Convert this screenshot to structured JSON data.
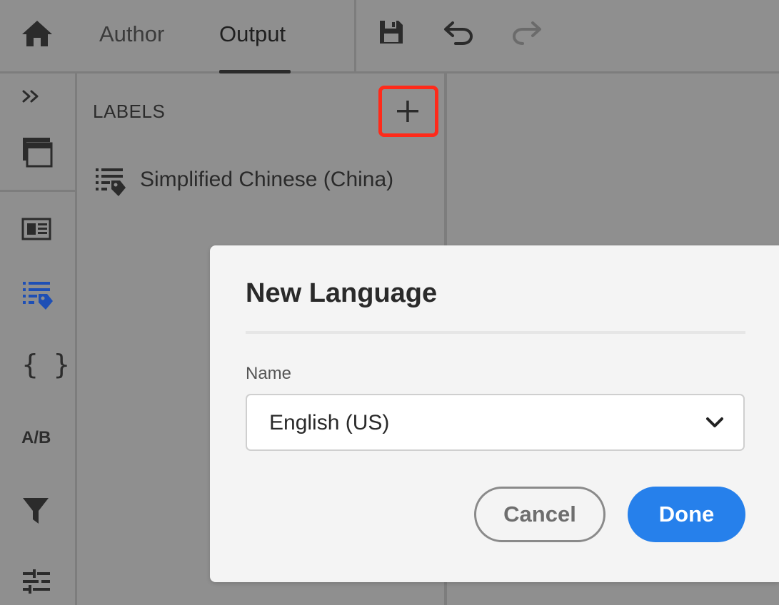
{
  "header": {
    "tabs": [
      {
        "label": "Author",
        "selected": false
      },
      {
        "label": "Output",
        "selected": true
      }
    ],
    "icons": [
      "home-icon",
      "save-icon",
      "undo-icon",
      "redo-icon"
    ]
  },
  "rail": {
    "icons": [
      "expand-icon",
      "panels-icon",
      "article-icon",
      "labels-icon",
      "braces-icon",
      "ab-test-icon",
      "filter-icon",
      "adjust-icon"
    ],
    "ab_label": "A/B",
    "braces_label": "{ }",
    "active_color": "#1e4fb5"
  },
  "labels_panel": {
    "title": "LABELS",
    "items": [
      {
        "label": "Simplified Chinese (China)",
        "icon": "label-list-icon"
      }
    ],
    "highlight_color": "#ff2a1a"
  },
  "dialog": {
    "title": "New Language",
    "field_label": "Name",
    "select_value": "English (US)",
    "cancel_label": "Cancel",
    "done_label": "Done",
    "accent": "#2680eb"
  }
}
